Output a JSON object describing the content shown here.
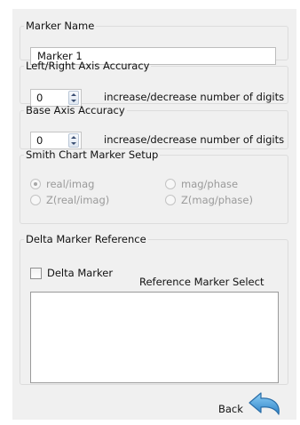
{
  "marker_name": {
    "legend": "Marker Name",
    "value": "Marker 1"
  },
  "left_right_accuracy": {
    "legend": "Left/Right Axis Accuracy",
    "value": "0",
    "hint": "increase/decrease number of digits"
  },
  "base_accuracy": {
    "legend": "Base Axis Accuracy",
    "value": "0",
    "hint": "increase/decrease number of digits"
  },
  "smith": {
    "legend": "Smith Chart Marker Setup",
    "options": [
      "real/imag",
      "mag/phase",
      "Z(real/imag)",
      "Z(mag/phase)"
    ],
    "selected": "real/imag",
    "enabled": false
  },
  "delta": {
    "legend": "Delta Marker Reference",
    "checkbox_label": "Delta Marker",
    "checked": false,
    "select_label": "Reference Marker Select",
    "items": []
  },
  "footer": {
    "back_label": "Back"
  },
  "colors": {
    "panel_bg": "#f0f0f0",
    "disabled_text": "#9a9a9a",
    "back_arrow": "#4a9ad4"
  },
  "icons": {
    "back": "curved-back-arrow-icon"
  }
}
